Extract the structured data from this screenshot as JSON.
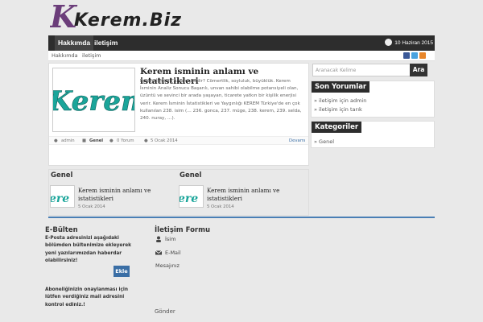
{
  "logo": {
    "text": "Kerem.Biz"
  },
  "nav": {
    "items": [
      "Hakkımda",
      "iletişim"
    ],
    "date": "10 Haziran 2015"
  },
  "subnav": {
    "items": [
      "Hakkımda",
      "iletişim"
    ]
  },
  "post": {
    "title": "Kerem isminin anlamı ve istatistikleri",
    "excerpt": "Kerem İsminin Anlamı Nedir? Cömertlik, soyluluk, büyüklük. Kerem İsminin Analiz Sonucu Başarılı, unvan sahibi olabilme potansiyeli olan, üzüntü ve sevinci bir arada yaşayan, ticarete yatkın bir kişilik enerjisi verir. Kerem İsminin İstatistikleri ve Yaygınlığı KEREM Türkiye'de en çok kullanılan 238. isim (… 236. gonca, 237. müge, 238. kerem, 239. selda, 240. nuray, …).",
    "thumb_text": "Kerem",
    "author": "admin",
    "category": "Genel",
    "comments": "0 Yorum",
    "date": "5 Ocak 2014",
    "more": "Devamı"
  },
  "search": {
    "placeholder": "Aranacak Kelime",
    "button": "Ara"
  },
  "recent_comments": {
    "title": "Son Yorumlar",
    "items": [
      {
        "link": "iletişim",
        "rest": " için admin"
      },
      {
        "link": "iletişim",
        "rest": " için tarık"
      }
    ]
  },
  "categories": {
    "title": "Kategoriler",
    "items": [
      "Genel"
    ]
  },
  "cat_columns": [
    {
      "heading": "Genel",
      "thumb_text": "ere",
      "title": "Kerem isminin anlamı ve istatistikleri",
      "date": "5 Ocak 2014"
    },
    {
      "heading": "Genel",
      "thumb_text": "ere",
      "title": "Kerem isminin anlamı ve istatistikleri",
      "date": "5 Ocak 2014"
    }
  ],
  "footer": {
    "ebulten": {
      "title": "E-Bülten",
      "text": "E-Posta adresinizi aşağıdaki bölümden bültenimize ekleyerek yeni yazılarımızdan haberdar olabilirsiniz!",
      "button": "Ekle",
      "note": "Aboneliğinizin onaylanması için lütfen verdiğiniz mail adresini kontrol ediniz.!"
    },
    "contact": {
      "title": "İletişim Formu",
      "name": "İsim",
      "email": "E-Mail",
      "message": "Mesajınız",
      "submit": "Gönder"
    }
  },
  "colors": {
    "accent": "#4a7fb5",
    "dark": "#2d2d2d",
    "logo": "#6b3d7a"
  }
}
